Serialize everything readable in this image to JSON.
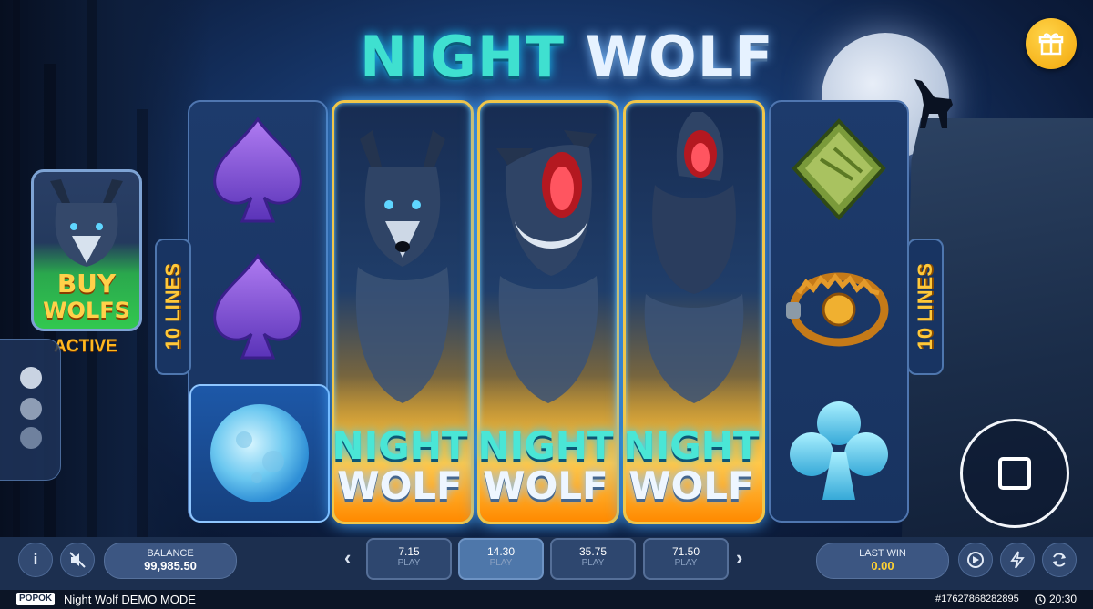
{
  "game": {
    "title_part1": "NIGHT",
    "title_part2": "WOLF"
  },
  "reels": [
    {
      "symbols": [
        "spade",
        "spade",
        "full-moon"
      ]
    },
    {
      "symbols": [
        "wolf-calm"
      ],
      "expanded": true
    },
    {
      "symbols": [
        "wolf-howl"
      ],
      "expanded": true
    },
    {
      "symbols": [
        "wolf-howl"
      ],
      "expanded": true
    },
    {
      "symbols": [
        "emerald-diamond",
        "bear-trap",
        "ice-club"
      ]
    }
  ],
  "reel_label": {
    "part1": "NIGHT",
    "part2": "WOLF"
  },
  "lines_left": "10 LINES",
  "lines_right": "10 LINES",
  "buy": {
    "line1": "BUY",
    "line2": "WOLFS",
    "status": "ACTIVE"
  },
  "balance": {
    "label": "BALANCE",
    "value": "99,985.50"
  },
  "bets": [
    {
      "value": "7.15",
      "label": "PLAY",
      "selected": false
    },
    {
      "value": "14.30",
      "label": "PLAY",
      "selected": true
    },
    {
      "value": "35.75",
      "label": "PLAY",
      "selected": false
    },
    {
      "value": "71.50",
      "label": "PLAY",
      "selected": false
    }
  ],
  "last_win": {
    "label": "LAST WIN",
    "value": "0.00"
  },
  "footer": {
    "brand": "POPOK",
    "game_name": "Night Wolf DEMO MODE",
    "round_id": "#17627868282895",
    "clock": "20:30"
  },
  "info_label": "i",
  "nav": {
    "prev": "‹",
    "next": "›"
  },
  "colors": {
    "accent_gold": "#ffc93a",
    "bar_bg": "#1c2f4f",
    "footer_bg": "#0c1526",
    "teal": "#3fe0d0"
  }
}
